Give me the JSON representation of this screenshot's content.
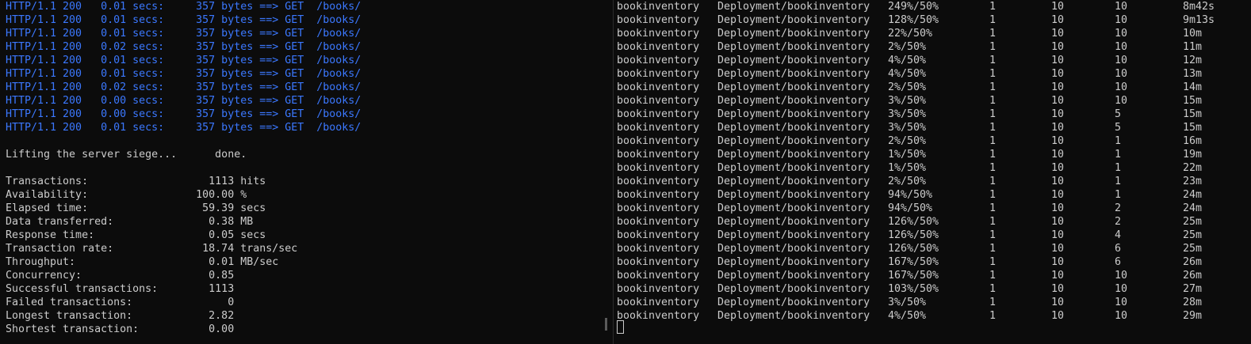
{
  "colors": {
    "background": "#0c0c0c",
    "text": "#cccccc",
    "http_line": "#3b78ff"
  },
  "left": {
    "http_lines": [
      "HTTP/1.1 200   0.01 secs:     357 bytes ==> GET  /books/",
      "HTTP/1.1 200   0.01 secs:     357 bytes ==> GET  /books/",
      "HTTP/1.1 200   0.01 secs:     357 bytes ==> GET  /books/",
      "HTTP/1.1 200   0.02 secs:     357 bytes ==> GET  /books/",
      "HTTP/1.1 200   0.01 secs:     357 bytes ==> GET  /books/",
      "HTTP/1.1 200   0.01 secs:     357 bytes ==> GET  /books/",
      "HTTP/1.1 200   0.02 secs:     357 bytes ==> GET  /books/",
      "HTTP/1.1 200   0.00 secs:     357 bytes ==> GET  /books/",
      "HTTP/1.1 200   0.00 secs:     357 bytes ==> GET  /books/",
      "HTTP/1.1 200   0.01 secs:     357 bytes ==> GET  /books/"
    ],
    "done_line": "Lifting the server siege...      done.",
    "stats": [
      "Transactions:                   1113 hits",
      "Availability:                 100.00 %",
      "Elapsed time:                  59.39 secs",
      "Data transferred:               0.38 MB",
      "Response time:                  0.05 secs",
      "Transaction rate:              18.74 trans/sec",
      "Throughput:                     0.01 MB/sec",
      "Concurrency:                    0.85",
      "Successful transactions:        1113",
      "Failed transactions:               0",
      "Longest transaction:            2.82",
      "Shortest transaction:           0.00"
    ]
  },
  "right": {
    "rows": [
      [
        "bookinventory",
        "Deployment/bookinventory",
        "249%/50%",
        "1",
        "10",
        "10",
        "8m42s"
      ],
      [
        "bookinventory",
        "Deployment/bookinventory",
        "128%/50%",
        "1",
        "10",
        "10",
        "9m13s"
      ],
      [
        "bookinventory",
        "Deployment/bookinventory",
        "22%/50%",
        "1",
        "10",
        "10",
        "10m"
      ],
      [
        "bookinventory",
        "Deployment/bookinventory",
        "2%/50%",
        "1",
        "10",
        "10",
        "11m"
      ],
      [
        "bookinventory",
        "Deployment/bookinventory",
        "4%/50%",
        "1",
        "10",
        "10",
        "12m"
      ],
      [
        "bookinventory",
        "Deployment/bookinventory",
        "4%/50%",
        "1",
        "10",
        "10",
        "13m"
      ],
      [
        "bookinventory",
        "Deployment/bookinventory",
        "2%/50%",
        "1",
        "10",
        "10",
        "14m"
      ],
      [
        "bookinventory",
        "Deployment/bookinventory",
        "3%/50%",
        "1",
        "10",
        "10",
        "15m"
      ],
      [
        "bookinventory",
        "Deployment/bookinventory",
        "3%/50%",
        "1",
        "10",
        "5",
        "15m"
      ],
      [
        "bookinventory",
        "Deployment/bookinventory",
        "3%/50%",
        "1",
        "10",
        "5",
        "15m"
      ],
      [
        "bookinventory",
        "Deployment/bookinventory",
        "2%/50%",
        "1",
        "10",
        "1",
        "16m"
      ],
      [
        "bookinventory",
        "Deployment/bookinventory",
        "1%/50%",
        "1",
        "10",
        "1",
        "19m"
      ],
      [
        "bookinventory",
        "Deployment/bookinventory",
        "1%/50%",
        "1",
        "10",
        "1",
        "22m"
      ],
      [
        "bookinventory",
        "Deployment/bookinventory",
        "2%/50%",
        "1",
        "10",
        "1",
        "23m"
      ],
      [
        "bookinventory",
        "Deployment/bookinventory",
        "94%/50%",
        "1",
        "10",
        "1",
        "24m"
      ],
      [
        "bookinventory",
        "Deployment/bookinventory",
        "94%/50%",
        "1",
        "10",
        "2",
        "24m"
      ],
      [
        "bookinventory",
        "Deployment/bookinventory",
        "126%/50%",
        "1",
        "10",
        "2",
        "25m"
      ],
      [
        "bookinventory",
        "Deployment/bookinventory",
        "126%/50%",
        "1",
        "10",
        "4",
        "25m"
      ],
      [
        "bookinventory",
        "Deployment/bookinventory",
        "126%/50%",
        "1",
        "10",
        "6",
        "25m"
      ],
      [
        "bookinventory",
        "Deployment/bookinventory",
        "167%/50%",
        "1",
        "10",
        "6",
        "26m"
      ],
      [
        "bookinventory",
        "Deployment/bookinventory",
        "167%/50%",
        "1",
        "10",
        "10",
        "26m"
      ],
      [
        "bookinventory",
        "Deployment/bookinventory",
        "103%/50%",
        "1",
        "10",
        "10",
        "27m"
      ],
      [
        "bookinventory",
        "Deployment/bookinventory",
        "3%/50%",
        "1",
        "10",
        "10",
        "28m"
      ],
      [
        "bookinventory",
        "Deployment/bookinventory",
        "4%/50%",
        "1",
        "10",
        "10",
        "29m"
      ]
    ]
  }
}
